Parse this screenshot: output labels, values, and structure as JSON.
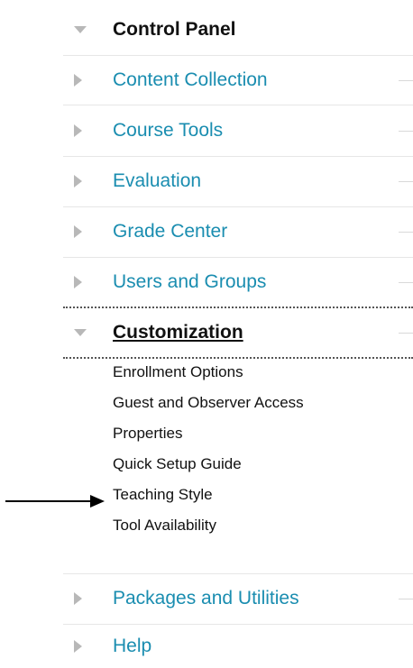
{
  "header": {
    "title": "Control Panel"
  },
  "menu": {
    "items": [
      {
        "label": "Content Collection"
      },
      {
        "label": "Course Tools"
      },
      {
        "label": "Evaluation"
      },
      {
        "label": "Grade Center"
      },
      {
        "label": "Users and Groups"
      }
    ],
    "expanded": {
      "label": "Customization",
      "subitems": [
        {
          "label": "Enrollment Options"
        },
        {
          "label": "Guest and Observer Access"
        },
        {
          "label": "Properties"
        },
        {
          "label": "Quick Setup Guide"
        },
        {
          "label": "Teaching Style"
        },
        {
          "label": "Tool Availability"
        }
      ]
    },
    "after": [
      {
        "label": "Packages and Utilities"
      },
      {
        "label": "Help"
      }
    ]
  },
  "colors": {
    "link": "#1a8db0",
    "text": "#111111",
    "triangle": "#b8b8b8"
  },
  "annotation": {
    "icon": "right-arrow-icon",
    "points_to": "Teaching Style"
  }
}
